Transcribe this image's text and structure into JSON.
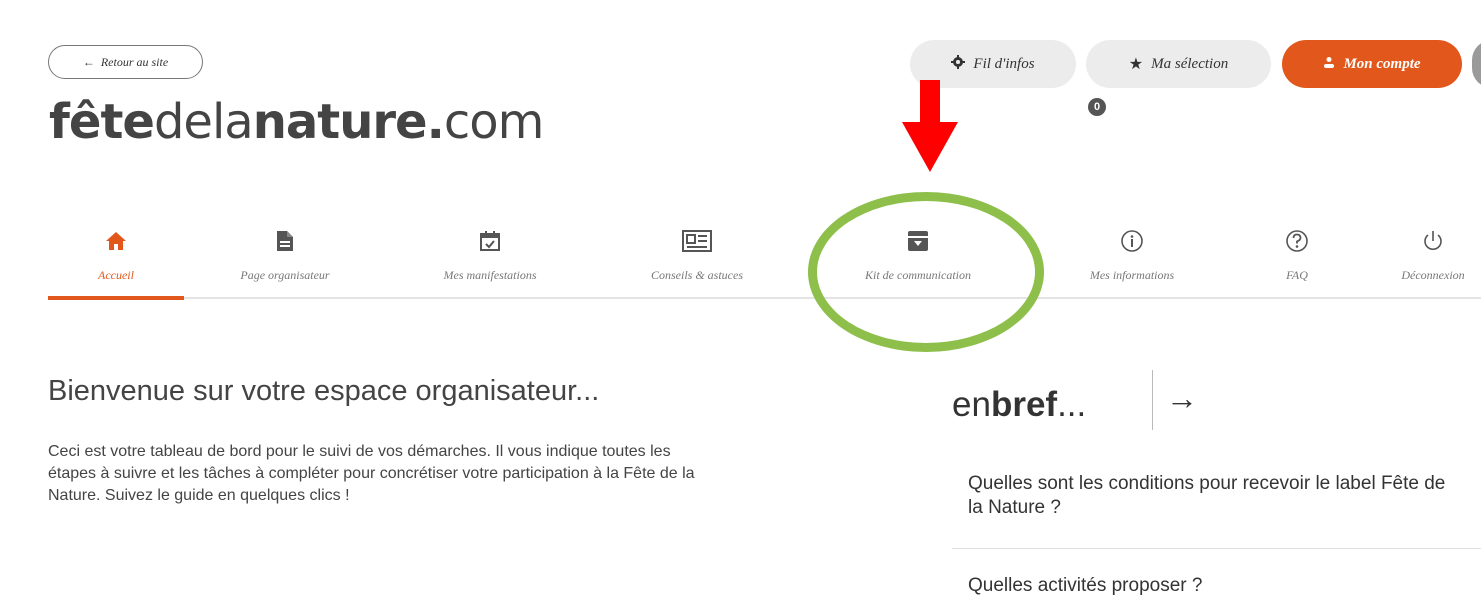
{
  "header": {
    "back_label": "Retour au site",
    "logo": {
      "part1": "fête",
      "part2": "dela",
      "part3": "nature.",
      "part4": "com"
    },
    "buttons": {
      "fil_label": "Fil d'infos",
      "selection_label": "Ma sélection",
      "selection_count": "0",
      "account_label": "Mon compte"
    },
    "accent_color": "#e2581c"
  },
  "nav": {
    "items": [
      {
        "label": "Accueil",
        "icon": "home-icon"
      },
      {
        "label": "Page organisateur",
        "icon": "document-icon"
      },
      {
        "label": "Mes manifestations",
        "icon": "calendar-check-icon"
      },
      {
        "label": "Conseils & astuces",
        "icon": "newspaper-icon"
      },
      {
        "label": "Kit de communication",
        "icon": "archive-download-icon"
      },
      {
        "label": "Mes informations",
        "icon": "info-icon"
      },
      {
        "label": "FAQ",
        "icon": "help-icon"
      },
      {
        "label": "Déconnexion",
        "icon": "power-icon"
      }
    ],
    "active_index": 0
  },
  "annotation": {
    "arrow_color": "#ff0000",
    "circle_color": "#8dbf4a"
  },
  "main": {
    "welcome_title": "Bienvenue sur votre espace organisateur...",
    "intro_text": "Ceci est votre tableau de bord pour le suivi de vos démarches. Il vous indique toutes les étapes à suivre et les tâches à compléter pour concrétiser votre participation à la Fête de la Nature. Suivez le guide en quelques clics !"
  },
  "bref": {
    "title_part1": "en ",
    "title_part2": "bref",
    "title_part3": "...",
    "questions": [
      "Quelles sont les conditions pour recevoir le label Fête de la Nature ?",
      "Quelles activités proposer ?"
    ]
  }
}
